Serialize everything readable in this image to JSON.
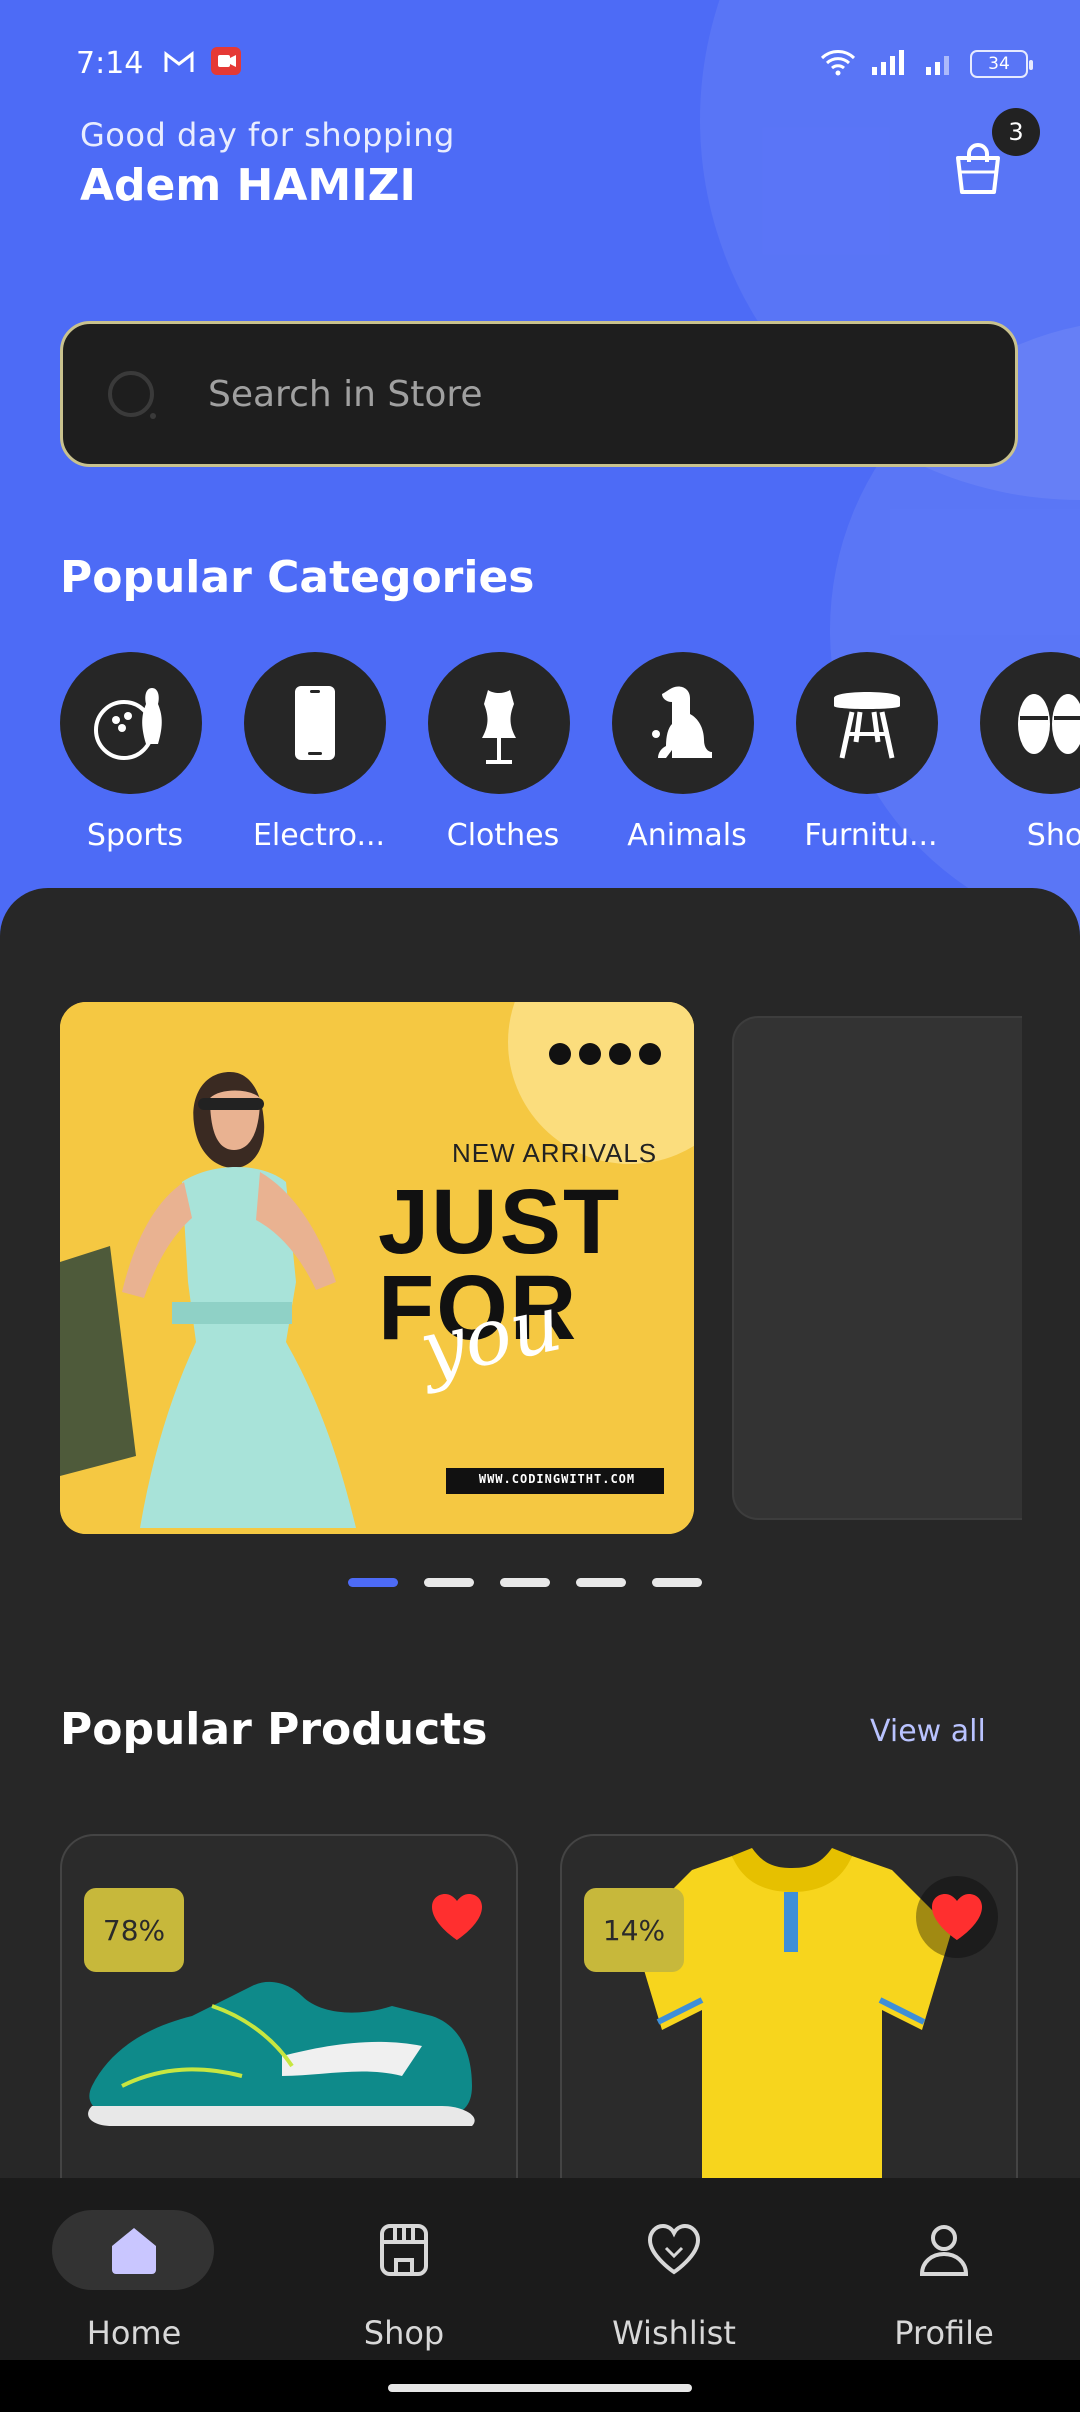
{
  "status": {
    "time": "7:14",
    "battery": "34"
  },
  "header": {
    "greeting": "Good day for shopping",
    "username": "Adem HAMIZI",
    "cart_count": "3"
  },
  "search": {
    "placeholder": "Search in Store"
  },
  "categories": {
    "title": "Popular Categories",
    "items": [
      {
        "label": "Sports",
        "icon": "bowling-icon"
      },
      {
        "label": "Electro...",
        "icon": "phone-icon"
      },
      {
        "label": "Clothes",
        "icon": "dress-form-icon"
      },
      {
        "label": "Animals",
        "icon": "dog-icon"
      },
      {
        "label": "Furnitu...",
        "icon": "chair-icon"
      },
      {
        "label": "Sho",
        "icon": "slippers-icon"
      }
    ]
  },
  "banner": {
    "subtitle": "NEW ARRIVALS",
    "title_line1": "JUST",
    "title_line2": "FOR",
    "script_text": "you",
    "url": "WWW.CODINGWITHT.COM",
    "page_count": 5,
    "active_index": 0
  },
  "products": {
    "title": "Popular Products",
    "view_all": "View all",
    "items": [
      {
        "discount": "78%",
        "name_icon": "sneaker-image",
        "favorite": true
      },
      {
        "discount": "14%",
        "name_icon": "polo-shirt-image",
        "favorite": true
      }
    ]
  },
  "nav": {
    "items": [
      {
        "label": "Home",
        "icon": "home-icon",
        "active": true
      },
      {
        "label": "Shop",
        "icon": "shop-icon",
        "active": false
      },
      {
        "label": "Wishlist",
        "icon": "heart-icon",
        "active": false
      },
      {
        "label": "Profile",
        "icon": "user-icon",
        "active": false
      }
    ]
  },
  "colors": {
    "primary": "#4d6bf6",
    "dark_bg": "#272727",
    "banner_yellow": "#f5c842",
    "discount_badge": "#c7b83b",
    "heart_red": "#ff2f2f"
  }
}
